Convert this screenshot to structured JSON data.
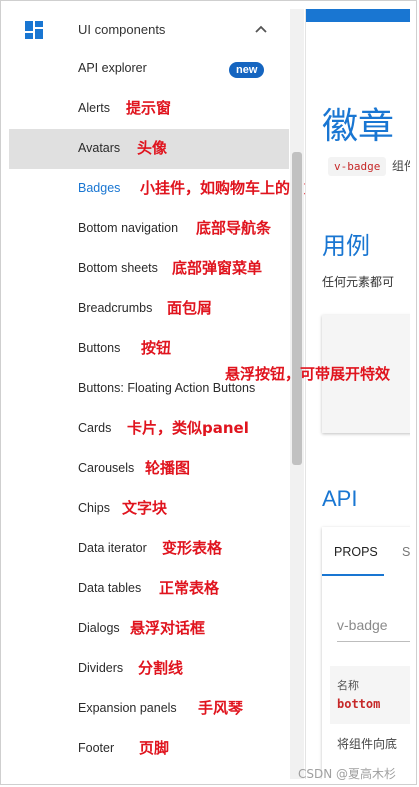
{
  "sidebar": {
    "group_title": "UI components",
    "group_icon": "dashboard-icon",
    "expand_icon": "chevron-up-icon",
    "items": [
      {
        "label": "API explorer",
        "badge": "new",
        "annotation": ""
      },
      {
        "label": "Alerts",
        "annotation": "提示窗"
      },
      {
        "label": "Avatars",
        "annotation": "头像",
        "hovered": true
      },
      {
        "label": "Badges",
        "annotation": "小挂件，如购物车上的数字",
        "selected": true
      },
      {
        "label": "Bottom navigation",
        "annotation": "底部导航条"
      },
      {
        "label": "Bottom sheets",
        "annotation": "底部弹窗菜单"
      },
      {
        "label": "Breadcrumbs",
        "annotation": "面包屑"
      },
      {
        "label": "Buttons",
        "annotation": "按钮"
      },
      {
        "label": "Buttons: Floating Action Buttons",
        "annotation": "悬浮按钮，可带展开特效"
      },
      {
        "label": "Cards",
        "annotation": "卡片，类似panel"
      },
      {
        "label": "Carousels",
        "annotation": "轮播图"
      },
      {
        "label": "Chips",
        "annotation": "文字块"
      },
      {
        "label": "Data iterator",
        "annotation": "变形表格"
      },
      {
        "label": "Data tables",
        "annotation": "正常表格"
      },
      {
        "label": "Dialogs",
        "annotation": "悬浮对话框"
      },
      {
        "label": "Dividers",
        "annotation": "分割线"
      },
      {
        "label": "Expansion panels",
        "annotation": "手风琴"
      },
      {
        "label": "Footer",
        "annotation": "页脚"
      }
    ]
  },
  "main": {
    "title": "徽章",
    "component_tag": "v-badge",
    "description": "组件",
    "usage_title": "用例",
    "usage_desc": "任何元素都可",
    "api_title": "API",
    "tabs": [
      "PROPS",
      "S"
    ],
    "props_placeholder": "v-badge",
    "table": {
      "col_name": "名称",
      "prop_name": "bottom",
      "prop_desc": "将组件向底"
    }
  },
  "watermark": "CSDN @夏高木杉",
  "colors": {
    "accent": "#1976d2",
    "annotation": "#e0141e",
    "badge": "#1565c0",
    "code": "#c62828"
  }
}
